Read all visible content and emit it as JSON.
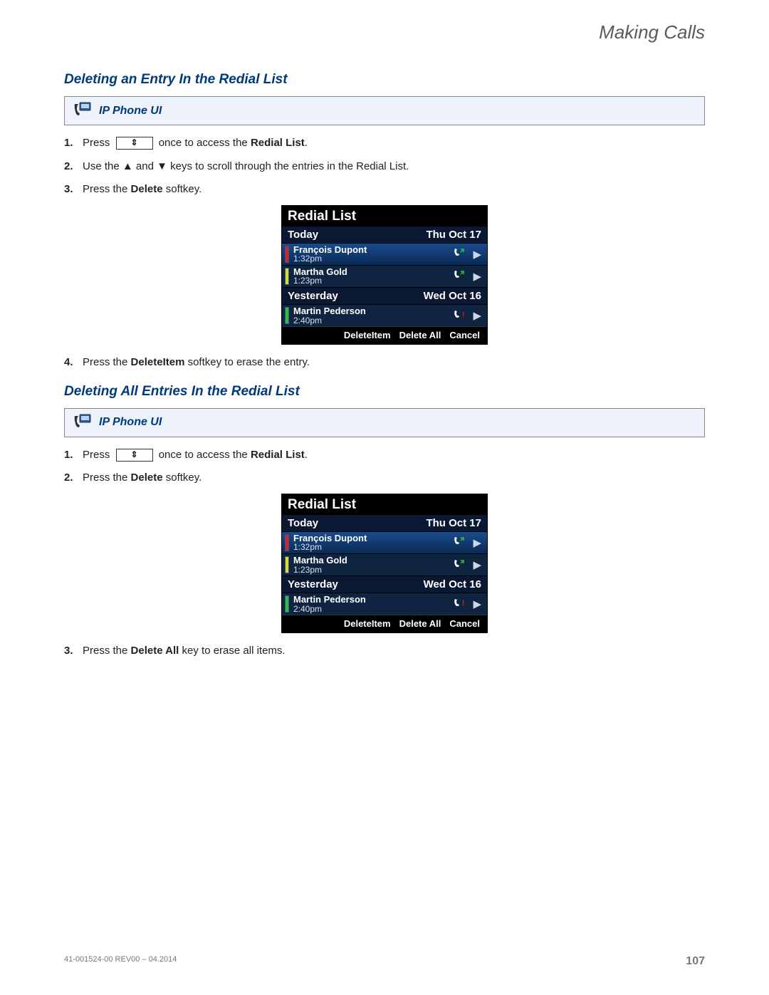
{
  "header": {
    "chapter": "Making Calls"
  },
  "sections": {
    "s1": {
      "title": "Deleting an Entry In the Redial List",
      "banner": "IP Phone UI",
      "steps": {
        "1a": "Press",
        "1b": "once to access the",
        "1c": "Redial List",
        "1d": ".",
        "2a": "Use the",
        "2b": "and",
        "2c": "keys to scroll through the entries in the Redial List.",
        "3a": "Press the",
        "3b": "Delete",
        "3c": "softkey.",
        "4a": "Press the",
        "4b": "DeleteItem",
        "4c": "softkey to erase the entry."
      }
    },
    "s2": {
      "title": "Deleting All Entries In the Redial List",
      "banner": "IP Phone UI",
      "steps": {
        "1a": "Press",
        "1b": "once to access the",
        "1c": "Redial List",
        "1d": ".",
        "2a": "Press the",
        "2b": "Delete",
        "2c": "softkey.",
        "3a": "Press the",
        "3b": "Delete All",
        "3c": "key to erase all items."
      }
    }
  },
  "phone": {
    "title": "Redial List",
    "days": [
      {
        "label": "Today",
        "date": "Thu Oct 17"
      },
      {
        "label": "Yesterday",
        "date": "Wed Oct 16"
      }
    ],
    "entries": [
      {
        "name": "François Dupont",
        "time": "1:32pm",
        "presence": "red",
        "selected": true,
        "missed": false
      },
      {
        "name": "Martha Gold",
        "time": "1:23pm",
        "presence": "yellow",
        "selected": false,
        "missed": false
      },
      {
        "name": "Martin Pederson",
        "time": "2:40pm",
        "presence": "green",
        "selected": false,
        "missed": true
      }
    ],
    "softkeys": [
      "DeleteItem",
      "Delete All",
      "Cancel"
    ]
  },
  "footer": {
    "doc": "41-001524-00 REV00 – 04.2014",
    "page": "107"
  }
}
